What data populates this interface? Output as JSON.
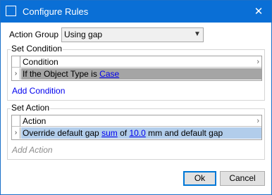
{
  "window": {
    "title": "Configure Rules",
    "close_glyph": "✕"
  },
  "action_group": {
    "label": "Action Group",
    "selected": "Using gap"
  },
  "set_condition": {
    "title": "Set Condition",
    "column_header": "Condition",
    "rows": [
      {
        "prefix": "If the Object Type is ",
        "link": "Case"
      }
    ],
    "add_label": "Add Condition"
  },
  "set_action": {
    "title": "Set Action",
    "column_header": "Action",
    "rows": [
      {
        "prefix": "Override default gap ",
        "link1": "sum",
        "mid": " of ",
        "link2": "10.0",
        "suffix": " mm and default gap"
      }
    ],
    "add_label": "Add Action"
  },
  "buttons": {
    "ok": "Ok",
    "cancel": "Cancel"
  },
  "icons": {
    "app": "window-icon",
    "dropdown": "chevron-down-icon",
    "row_selector": "chevron-right-icon"
  },
  "colors": {
    "titlebar": "#0a6fd6",
    "condition_selected_row": "#a5a5a5",
    "action_selected_row": "#b2cdeb",
    "link": "#0000ee"
  }
}
